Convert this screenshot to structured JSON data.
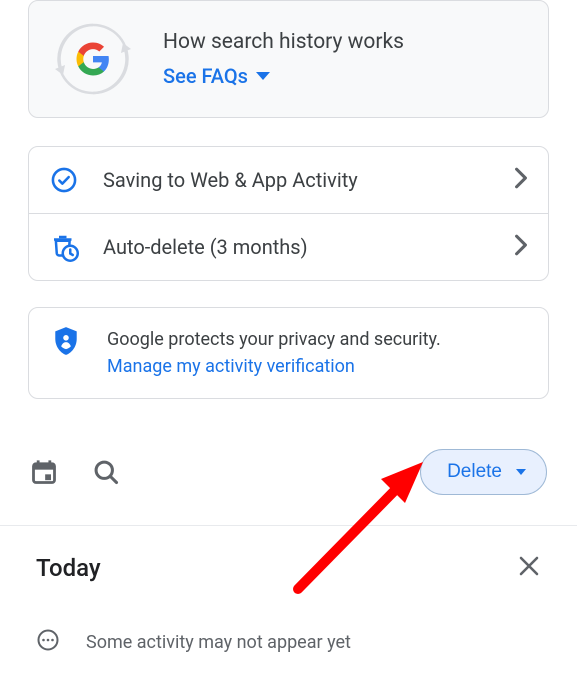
{
  "faq": {
    "title": "How search history works",
    "link": "See FAQs"
  },
  "rows": {
    "saving": "Saving to Web & App Activity",
    "autoDelete": "Auto-delete (3 months)"
  },
  "privacy": {
    "text": "Google protects your privacy and security.",
    "link": "Manage my activity verification"
  },
  "toolbar": {
    "delete": "Delete"
  },
  "today": {
    "heading": "Today"
  },
  "notice": {
    "text": "Some activity may not appear yet"
  }
}
